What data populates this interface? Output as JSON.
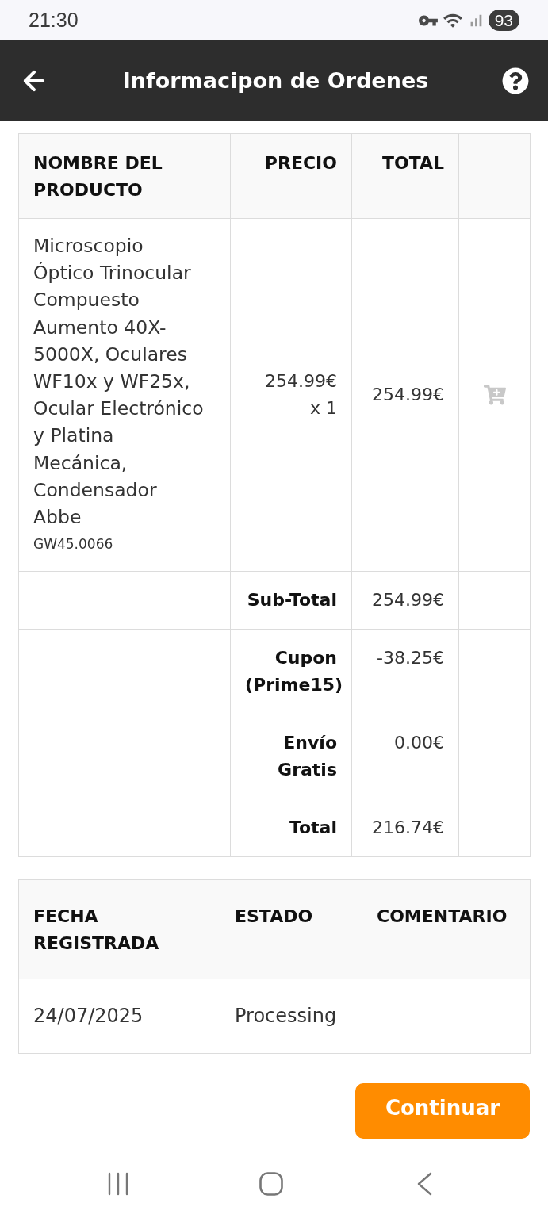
{
  "status_bar": {
    "time": "21:30",
    "battery": "93"
  },
  "header": {
    "title": "Informacipon de Ordenes"
  },
  "order_table": {
    "columns": [
      "NOMBRE DEL PRODUCTO",
      "PRECIO",
      "TOTAL"
    ],
    "items": [
      {
        "name": "Microscopio Óptico Trinocular Compuesto Aumento 40X-5000X, Oculares WF10x y WF25x, Ocular Electrónico y Platina Mecánica, Condensador Abbe",
        "sku": "GW45.0066",
        "price": "254.99€",
        "quantity": "x 1",
        "total": "254.99€"
      }
    ],
    "summary": [
      {
        "label": "Sub-Total",
        "value": "254.99€"
      },
      {
        "label": "Cupon (Prime15)",
        "value": "-38.25€"
      },
      {
        "label": "Envío Gratis",
        "value": "0.00€"
      },
      {
        "label": "Total",
        "value": "216.74€"
      }
    ]
  },
  "history_table": {
    "columns": [
      "FECHA REGISTRADA",
      "ESTADO",
      "COMENTARIO"
    ],
    "rows": [
      {
        "date": "24/07/2025",
        "status": "Processing"
      }
    ]
  },
  "continue_button": {
    "label": "Continuar"
  }
}
